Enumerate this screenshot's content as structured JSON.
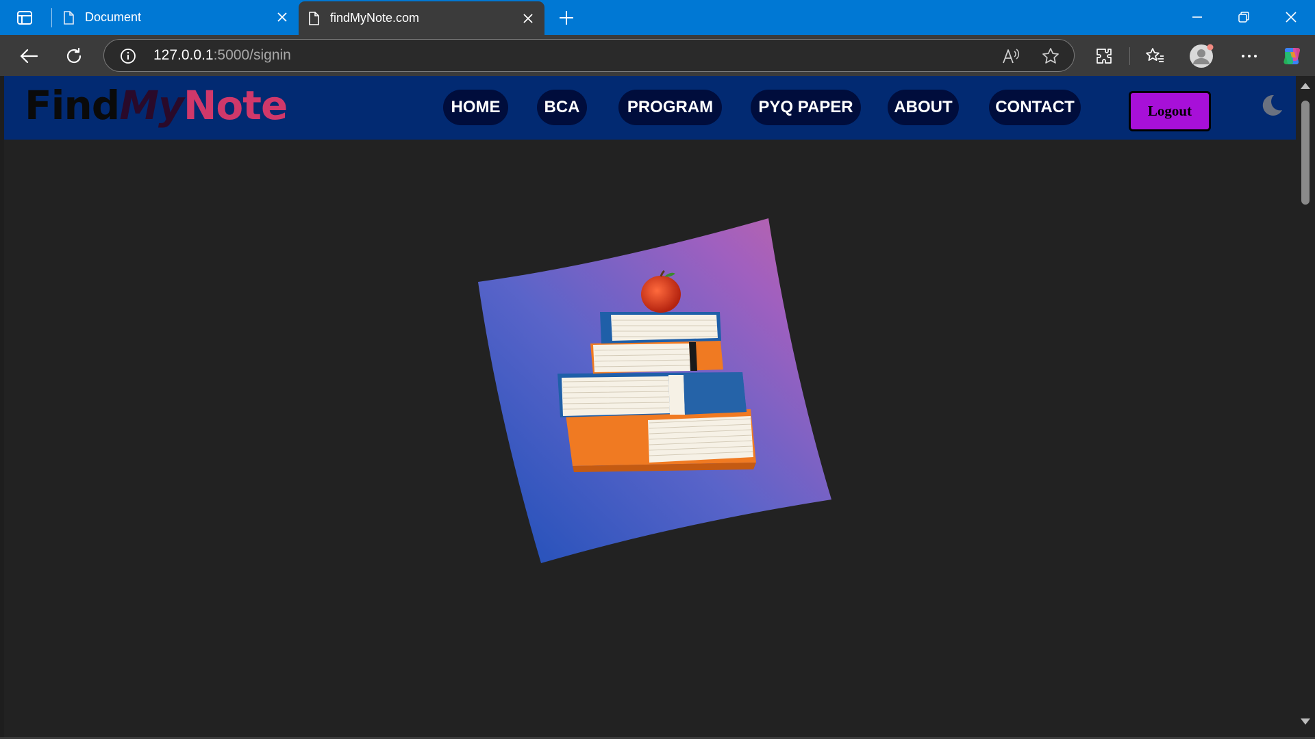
{
  "browser": {
    "tabs": [
      {
        "title": "Document",
        "active": false
      },
      {
        "title": "findMyNote.com",
        "active": true
      }
    ],
    "url": {
      "host": "127.0.0.1",
      "path": ":5000/signin"
    },
    "accent_color": "#0078d4"
  },
  "site": {
    "logo": {
      "part1": "Find",
      "part2": "My",
      "part3": "Note"
    },
    "nav": [
      {
        "label": "HOME"
      },
      {
        "label": "BCA"
      },
      {
        "label": "PROGRAM"
      },
      {
        "label": "PYQ PAPER"
      },
      {
        "label": "ABOUT"
      },
      {
        "label": "CONTACT"
      }
    ],
    "logout_label": "Logout",
    "colors": {
      "navbar": "#022a72",
      "nav_pill": "#000d3c",
      "logout": "#a710d8",
      "page_bg": "#222222"
    },
    "theme_toggle_icon": "moon-icon",
    "hero_image": "books-with-apple-illustration"
  }
}
